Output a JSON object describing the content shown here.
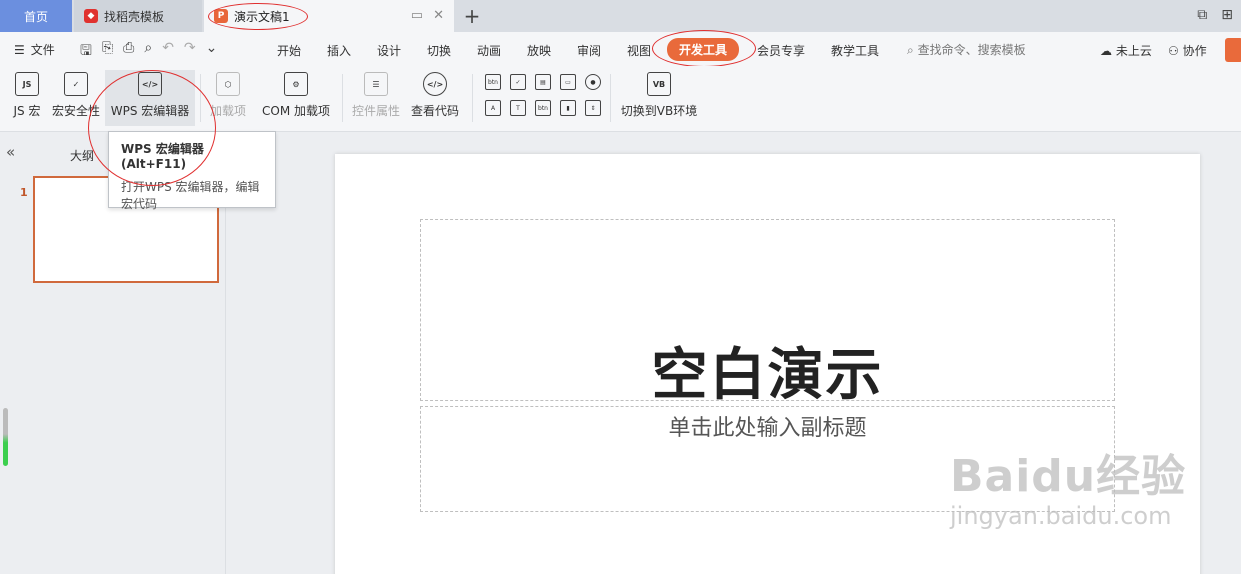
{
  "tabs": {
    "home": "首页",
    "template": "找稻壳模板",
    "document": "演示文稿1",
    "add": "+"
  },
  "menu": {
    "file": "文件",
    "tabs": [
      "开始",
      "插入",
      "设计",
      "切换",
      "动画",
      "放映",
      "审阅",
      "视图",
      "开发工具",
      "会员专享",
      "教学工具"
    ],
    "active_tab": "开发工具",
    "search_placeholder": "查找命令、搜索模板",
    "cloud": "未上云",
    "collab": "协作"
  },
  "ribbon": {
    "js_macro": "JS 宏",
    "macro_security": "宏安全性",
    "wps_macro_editor": "WPS 宏编辑器",
    "addins": "加载项",
    "com_addins": "COM 加载项",
    "control_props": "控件属性",
    "view_code": "查看代码",
    "switch_vb": "切换到VB环境",
    "small_btn": "btn",
    "small_a": "A",
    "small_t": "T",
    "icon_js": "JS",
    "icon_vb": "VB"
  },
  "tooltip": {
    "title": "WPS 宏编辑器 (Alt+F11)",
    "desc": "打开WPS 宏编辑器，编辑宏代码"
  },
  "panel": {
    "outline": "大纲",
    "slide_number": "1"
  },
  "slide": {
    "title": "空白演示",
    "subtitle": "单击此处输入副标题"
  },
  "watermark": {
    "main": "Baidu经验",
    "sub": "jingyan.baidu.com"
  },
  "colors": {
    "accent": "#e96a3b",
    "home_tab": "#6b8fdf",
    "annotation": "#e03030"
  }
}
